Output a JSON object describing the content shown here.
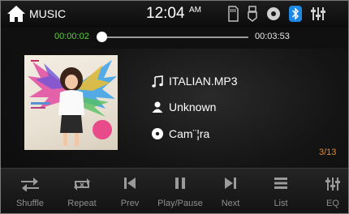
{
  "topbar": {
    "title": "MUSIC",
    "time": "12:04",
    "ampm": "AM",
    "icons": [
      "sd-card-icon",
      "usb-icon",
      "disc-icon",
      "bluetooth-icon",
      "equalizer-icon"
    ],
    "bluetooth_color": "#1e88e5"
  },
  "progress": {
    "elapsed": "00:00:02",
    "total": "00:03:53",
    "fraction": 0.009
  },
  "track": {
    "title": "ITALIAN.MP3",
    "artist": "Unknown",
    "album": "Cam¨¦ra",
    "counter": "3/13"
  },
  "controls": [
    {
      "label": "Shuffle",
      "icon": "shuffle-icon"
    },
    {
      "label": "Repeat",
      "icon": "repeat-icon"
    },
    {
      "label": "Prev",
      "icon": "prev-icon"
    },
    {
      "label": "Play/Pause",
      "icon": "play-pause-icon"
    },
    {
      "label": "Next",
      "icon": "next-icon"
    },
    {
      "label": "List",
      "icon": "list-icon"
    },
    {
      "label": "EQ",
      "icon": "equalizer-icon"
    }
  ],
  "colors": {
    "elapsed": "#5ad03c",
    "counter": "#e0892c",
    "label": "#8f8f8f"
  }
}
